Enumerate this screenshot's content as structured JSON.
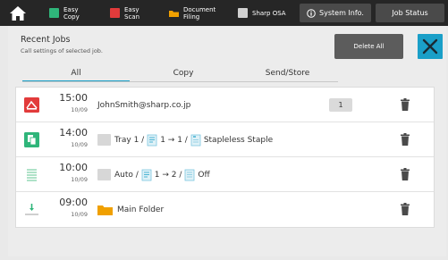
{
  "topbar": {
    "items": [
      {
        "label": "Easy\nCopy",
        "icon": "copy-icon",
        "color": "#2fb57a"
      },
      {
        "label": "Easy\nScan",
        "icon": "scan-icon",
        "color": "#e23b3b"
      },
      {
        "label": "Document\nFiling",
        "icon": "folder-icon",
        "color": "#f0a000"
      },
      {
        "label": "Sharp OSA",
        "icon": "osa-icon",
        "color": "#d0d0d0"
      }
    ],
    "system_info_label": "System Info.",
    "job_status_label": "Job Status"
  },
  "panel": {
    "title": "Recent Jobs",
    "subtitle": "Call settings of selected job.",
    "delete_all_label": "Delete All",
    "tabs": [
      "All",
      "Copy",
      "Send/Store"
    ],
    "active_tab": "All"
  },
  "jobs": [
    {
      "type_icon": "scan-email-icon",
      "time": "15:00",
      "date": "10/09",
      "detail": "JohnSmith@sharp.co.jp",
      "count": "1"
    },
    {
      "type_icon": "copy-icon",
      "time": "14:00",
      "date": "10/09",
      "tray": "Tray 1 /",
      "sides": "1 → 1 /",
      "finish": "Stapleless Staple"
    },
    {
      "type_icon": "copy-list-icon",
      "time": "10:00",
      "date": "10/09",
      "tray": "Auto /",
      "sides": "1 → 2 /",
      "finish": "Off"
    },
    {
      "type_icon": "document-filing-icon",
      "time": "09:00",
      "date": "10/09",
      "folder": "Main Folder"
    }
  ],
  "colors": {
    "accent": "#1a9fc8",
    "scan": "#e23b3b",
    "copy": "#2fb57a",
    "folder": "#f0a000"
  }
}
